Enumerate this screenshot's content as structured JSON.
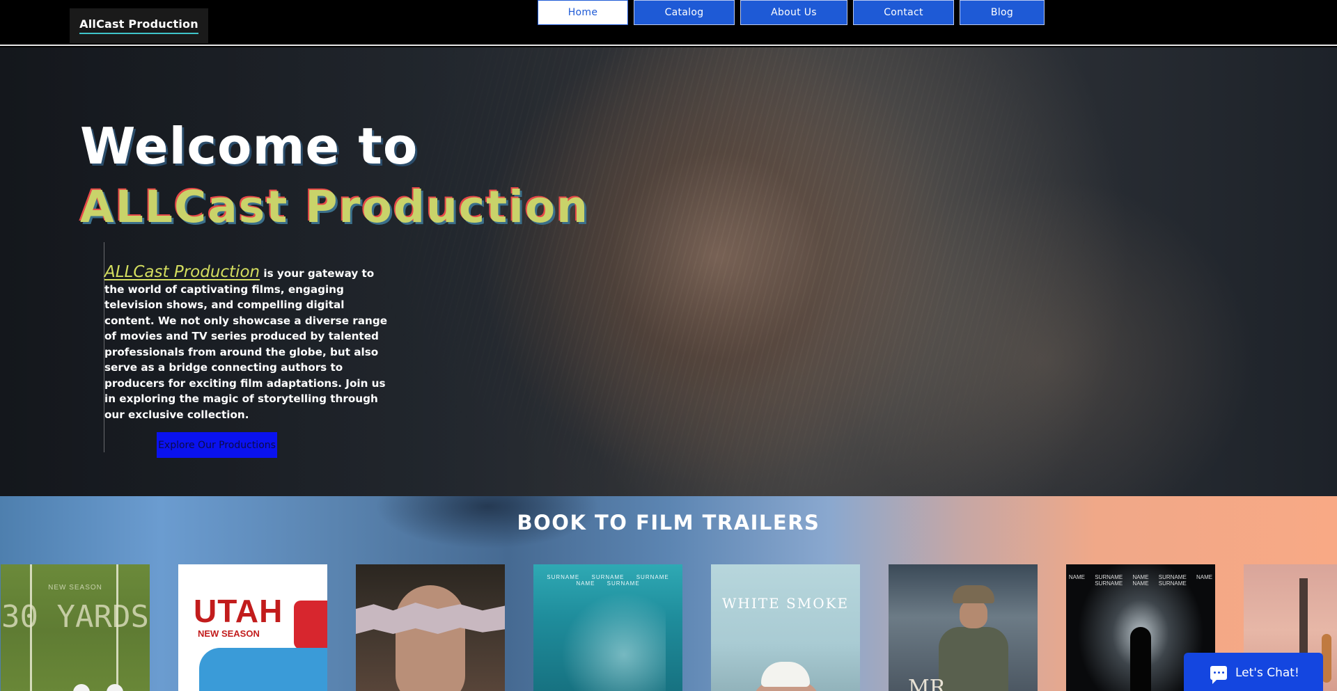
{
  "header": {
    "logo": "AllCast Production",
    "nav": [
      {
        "label": "Home",
        "active": true
      },
      {
        "label": "Catalog",
        "active": false
      },
      {
        "label": "About Us",
        "active": false
      },
      {
        "label": "Contact",
        "active": false
      },
      {
        "label": "Blog",
        "active": false
      }
    ]
  },
  "hero": {
    "welcome": "Welcome to",
    "brand": "ALLCast Production",
    "intro_brand": "ALLCast Production",
    "intro_text": " is your gateway to the world of captivating films, engaging television shows, and compelling digital content. We not only showcase a diverse range of movies and TV series produced by talented professionals from around the globe, but also serve as a bridge connecting authors to producers for exciting film adaptations. Join us in exploring the magic of storytelling through our exclusive collection.",
    "cta": "Explore Our Productions"
  },
  "trailers": {
    "title": "BOOK TO FILM TRAILERS",
    "posters": [
      {
        "small": "NEW SEASON",
        "big": "30 YARDS"
      },
      {
        "big": "UTAH",
        "small": "NEW SEASON"
      },
      {},
      {
        "names": "SURNAME SURNAME SURNAME NAME SURNAME"
      },
      {
        "big": "WHITE SMOKE"
      },
      {
        "big": "MR"
      },
      {
        "names": "NAME SURNAME NAME SURNAME NAME SURNAME NAME SURNAME"
      },
      {}
    ]
  },
  "chat": {
    "label": "Let's Chat!"
  },
  "colors": {
    "nav_blue": "#1e5ad6",
    "brand_green": "#c9d36a",
    "cta_blue": "#0a12ef",
    "chat_blue": "#1446e0"
  },
  "icons": {
    "chat": "chat-bubble-icon"
  }
}
